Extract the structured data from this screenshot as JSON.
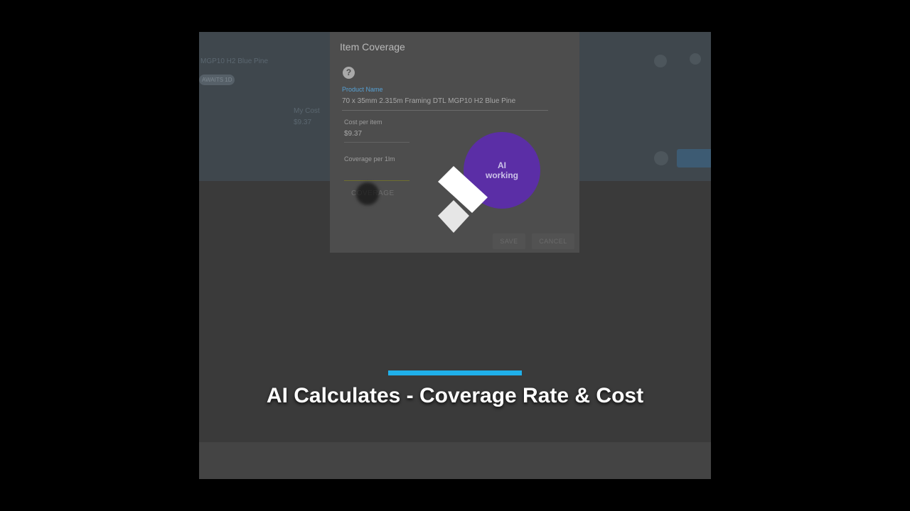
{
  "background_app": {
    "title": "MGP10 H2 Blue Pine",
    "chip": "AWAITS 1D",
    "my_cost_label": "My Cost",
    "my_cost_value": "$9.37"
  },
  "dialog": {
    "title": "Item Coverage",
    "product_name_label": "Product Name",
    "product_name_value": "70 x 35mm 2.315m Framing DTL MGP10 H2 Blue Pine",
    "cost_label": "Cost per item",
    "cost_value": "$9.37",
    "coverage_label": "Coverage per 1lm",
    "coverage_button": "COVERAGE",
    "save_label": "SAVE",
    "cancel_label": "CANCEL"
  },
  "overlay": {
    "ai_line1": "AI",
    "ai_line2": "working"
  },
  "caption": {
    "text": "AI Calculates - Coverage Rate & Cost"
  },
  "colors": {
    "accent": "#1fb0ea",
    "ai_circle": "#5b2ea6",
    "label_blue": "#56a0d3"
  }
}
